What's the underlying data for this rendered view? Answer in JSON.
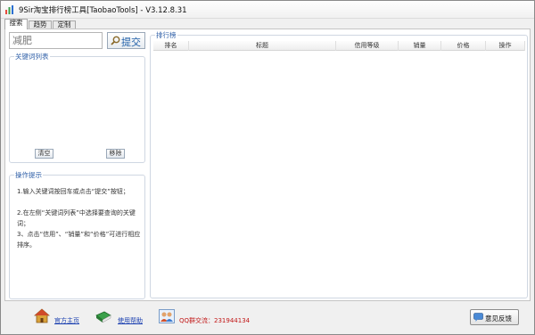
{
  "window": {
    "title": "9Sir淘宝排行榜工具[TaobaoTools] - V3.12.8.31"
  },
  "tabs": [
    {
      "label": "搜索",
      "active": true
    },
    {
      "label": "趋势",
      "active": false
    },
    {
      "label": "定制",
      "active": false
    }
  ],
  "search": {
    "value": "减肥",
    "submit_label": "提交"
  },
  "keyword_list": {
    "title": "关键词列表",
    "clear_label": "清空",
    "remove_label": "移除"
  },
  "tips": {
    "title": "操作提示",
    "lines": [
      "1.输入关键词按回车或点击“提交”按钮；",
      "2.在左侧“关键词列表”中选择要查询的关键词；",
      "3、点击“信用”、“销量”和“价格”可进行相应排序。"
    ]
  },
  "ranking": {
    "title": "排行榜",
    "columns": [
      "排名",
      "标题",
      "信用等级",
      "销量",
      "价格",
      "操作"
    ]
  },
  "footer": {
    "home_label": "官方主页",
    "help_label": "使用帮助",
    "qq_text": "QQ群交流：231944134",
    "feedback_label": "意见反馈"
  },
  "colors": {
    "link": "#1a3fb0",
    "qq": "#c21818",
    "group_title": "#3060a8"
  },
  "icons": [
    "app-icon",
    "search-icon",
    "home-icon",
    "book-icon",
    "users-icon",
    "chat-icon"
  ]
}
